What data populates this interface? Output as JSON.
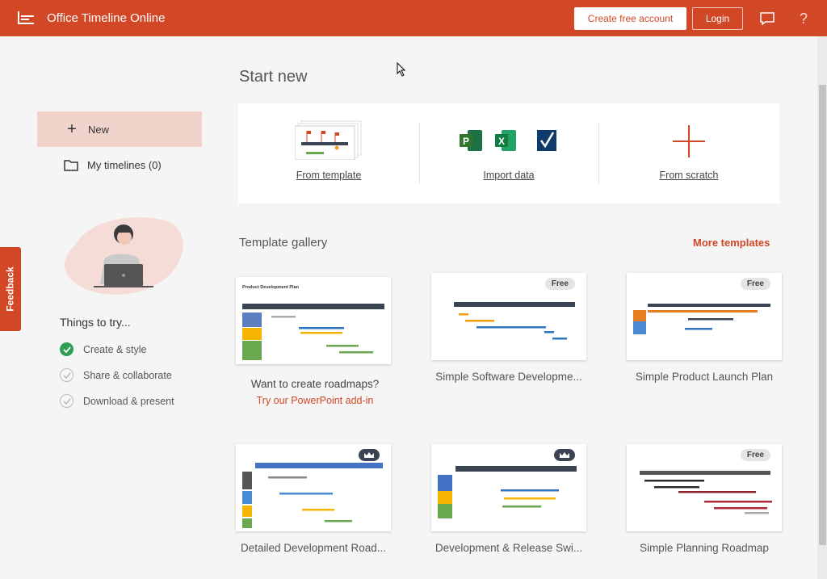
{
  "header": {
    "app_title": "Office Timeline Online",
    "create_account_label": "Create free account",
    "login_label": "Login",
    "help_glyph": "?"
  },
  "sidebar": {
    "items": [
      {
        "label": "New",
        "icon": "plus-icon",
        "active": true
      },
      {
        "label": "My timelines (0)",
        "icon": "folder-icon",
        "active": false
      }
    ],
    "things_title": "Things to try...",
    "try_items": [
      {
        "label": "Create & style",
        "done": true
      },
      {
        "label": "Share & collaborate",
        "done": false
      },
      {
        "label": "Download & present",
        "done": false
      }
    ]
  },
  "feedback_label": "Feedback",
  "start_new": {
    "title": "Start new",
    "options": [
      {
        "label": "From template"
      },
      {
        "label": "Import data"
      },
      {
        "label": "From scratch"
      }
    ]
  },
  "gallery": {
    "title": "Template gallery",
    "more_label": "More templates",
    "promo_card": {
      "heading": "Product Development Plan",
      "question": "Want to create roadmaps?",
      "link": "Try our PowerPoint add-in"
    },
    "templates": [
      {
        "title": "Simple Software Developme...",
        "badge": "Free"
      },
      {
        "title": "Simple Product Launch Plan",
        "badge": "Free"
      },
      {
        "title": "Detailed Development Road...",
        "badge": "premium"
      },
      {
        "title": "Development & Release Swi...",
        "badge": "premium"
      },
      {
        "title": "Simple Planning Roadmap",
        "badge": "Free"
      }
    ]
  },
  "colors": {
    "brand": "#d24726",
    "active_nav": "#f0d4cc",
    "check_done": "#2e9e53",
    "timeline_dark": "#3a4452"
  }
}
